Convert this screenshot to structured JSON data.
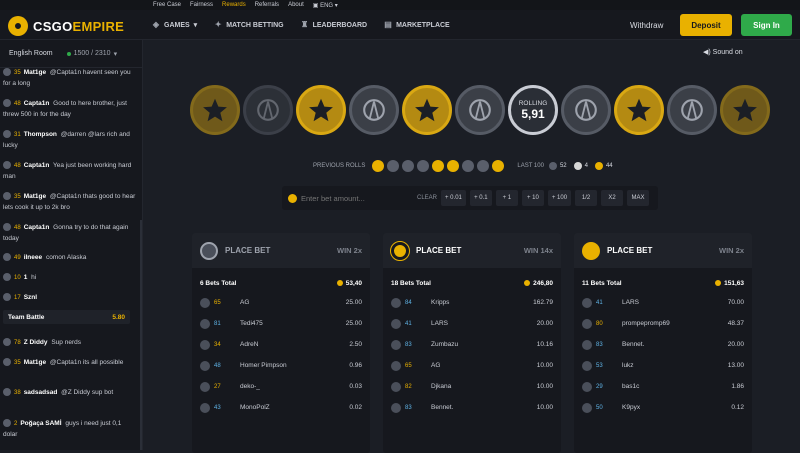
{
  "topnav": [
    "Free Case",
    "Fairness",
    "Rewards",
    "Referrals",
    "About",
    "ENG"
  ],
  "brand": {
    "logo_text_a": "CSGO",
    "logo_text_b": "EMPIRE"
  },
  "nav": {
    "games": "GAMES",
    "match_betting": "MATCH BETTING",
    "leaderboard": "LEADERBOARD",
    "marketplace": "MARKETPLACE"
  },
  "header": {
    "withdraw": "Withdraw",
    "deposit": "Deposit",
    "signin": "Sign In"
  },
  "chat": {
    "room": "English Room",
    "online": "1500 / 2310",
    "messages": [
      {
        "level": "35",
        "name": "Mat1ge",
        "text": "@Capta1n havent seen you for a long"
      },
      {
        "level": "48",
        "name": "Capta1n",
        "text": "Good to here brother, just threw 500 in for the day"
      },
      {
        "level": "31",
        "name": "Thompson",
        "text": "@darren @lars rich and lucky"
      },
      {
        "level": "48",
        "name": "Capta1n",
        "text": "Yea just been working hard man"
      },
      {
        "level": "35",
        "name": "Mat1ge",
        "text": "@Capta1n thats good to hear lets cook it up to 2k bro"
      },
      {
        "level": "48",
        "name": "Capta1n",
        "text": "Gonna try to do that again today"
      },
      {
        "level": "49",
        "name": "ilneee",
        "text": "comon Alaska"
      },
      {
        "level": "10",
        "name": "1",
        "text": "hi"
      },
      {
        "level": "17",
        "name": "Sznl",
        "text": ""
      },
      {
        "level": "78",
        "name": "Z Diddy",
        "text": "Sup nerds"
      },
      {
        "level": "35",
        "name": "Mat1ge",
        "text": "@Capta1n its all possible"
      },
      {
        "level": "38",
        "name": "sadsadsad",
        "text": "@Z Diddy sup bot"
      },
      {
        "level": "2",
        "name": "Poğaça SAMİ",
        "text": "guys i need just 0,1 dolar"
      }
    ],
    "team_battle": {
      "label": "Team Battle",
      "amount": "5.80"
    }
  },
  "sound": "Sound on",
  "roller": {
    "label": "ROLLING",
    "value": "5,91"
  },
  "previous": {
    "label": "PREVIOUS ROLLS",
    "last_label": "LAST 100",
    "ct_count": "52",
    "dice_count": "4",
    "t_count": "44"
  },
  "bet": {
    "placeholder": "Enter bet amount...",
    "clear": "CLEAR",
    "buttons": [
      "+ 0.01",
      "+ 0.1",
      "+ 1",
      "+ 10",
      "+ 100",
      "1/2",
      "X2",
      "MAX"
    ]
  },
  "panels": [
    {
      "title": "PLACE BET",
      "win": "WIN 2x",
      "total_label": "6 Bets Total",
      "total": "53,40",
      "accent": "#9ea3ad",
      "rows": [
        {
          "lv": "65",
          "name": "AG",
          "amount": "25.00"
        },
        {
          "lv": "81",
          "name": "Tedi475",
          "amount": "25.00"
        },
        {
          "lv": "34",
          "name": "AdreN",
          "amount": "2.50"
        },
        {
          "lv": "48",
          "name": "Homer Pimpson",
          "amount": "0.96"
        },
        {
          "lv": "27",
          "name": "deko-_",
          "amount": "0.03"
        },
        {
          "lv": "43",
          "name": "MonoPolZ",
          "amount": "0.02"
        }
      ]
    },
    {
      "title": "PLACE BET",
      "win": "WIN 14x",
      "total_label": "18 Bets Total",
      "total": "246,80",
      "accent": "#e9b100",
      "rows": [
        {
          "lv": "84",
          "name": "Kripps",
          "amount": "162.79"
        },
        {
          "lv": "41",
          "name": "LARS",
          "amount": "20.00"
        },
        {
          "lv": "83",
          "name": "Zumbazu",
          "amount": "10.16"
        },
        {
          "lv": "65",
          "name": "AG",
          "amount": "10.00"
        },
        {
          "lv": "82",
          "name": "Djkana",
          "amount": "10.00"
        },
        {
          "lv": "83",
          "name": "Bennet.",
          "amount": "10.00"
        }
      ]
    },
    {
      "title": "PLACE BET",
      "win": "WIN 2x",
      "total_label": "11 Bets Total",
      "total": "151,63",
      "accent": "#e9b100",
      "rows": [
        {
          "lv": "41",
          "name": "LARS",
          "amount": "70.00"
        },
        {
          "lv": "80",
          "name": "prompepromp69",
          "amount": "48.37"
        },
        {
          "lv": "83",
          "name": "Bennet.",
          "amount": "20.00"
        },
        {
          "lv": "53",
          "name": "lukz",
          "amount": "13.00"
        },
        {
          "lv": "29",
          "name": "bas1c",
          "amount": "1.86"
        },
        {
          "lv": "50",
          "name": "K9pyx",
          "amount": "0.12"
        }
      ]
    }
  ]
}
